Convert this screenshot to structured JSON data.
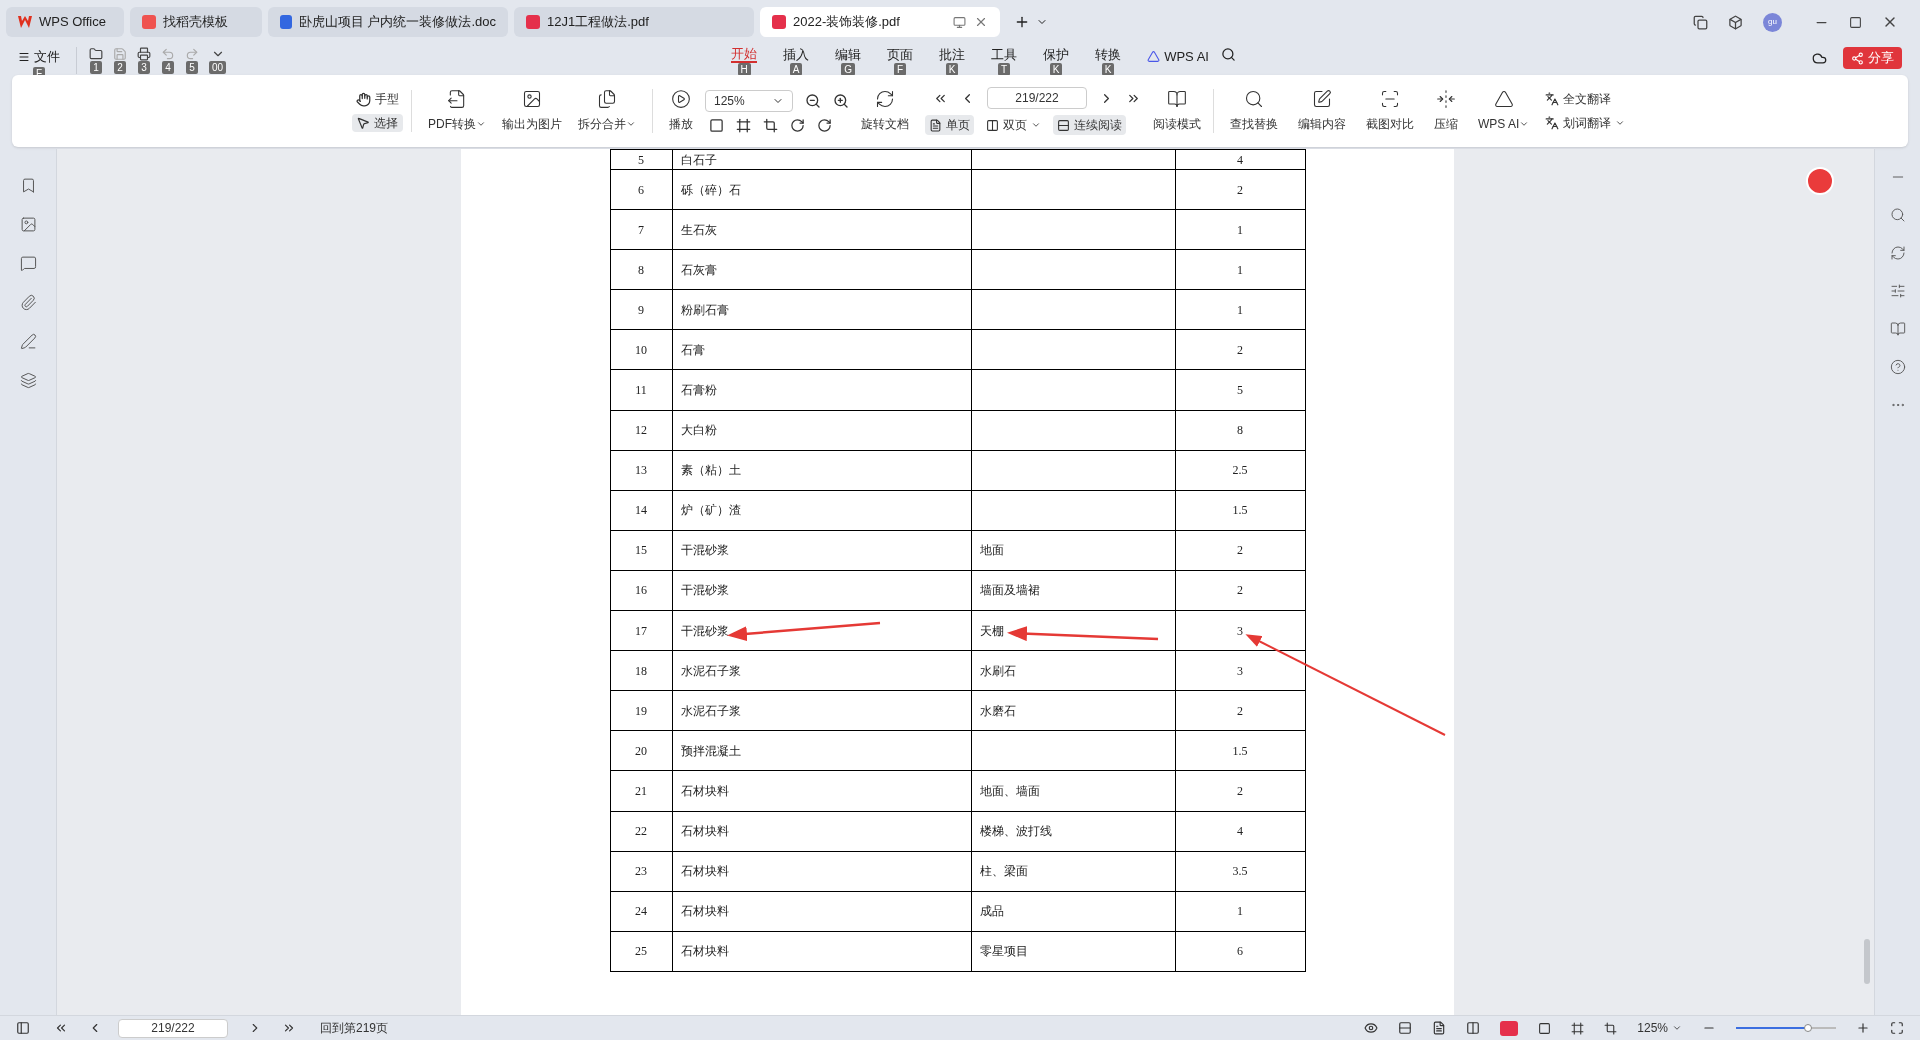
{
  "tabs": [
    {
      "label": "WPS Office",
      "kind": "home",
      "selected": false
    },
    {
      "label": "找稻壳模板",
      "kind": "template",
      "selected": false
    },
    {
      "label": "卧虎山项目 户内统一装修做法.doc",
      "kind": "doc",
      "selected": false
    },
    {
      "label": "12J1工程做法.pdf",
      "kind": "pdf",
      "selected": false
    },
    {
      "label": "2022-装饰装修.pdf",
      "kind": "pdf",
      "selected": true
    }
  ],
  "avatar": "gu",
  "quick_access": {
    "label": "文件",
    "hint": "F",
    "tool_hints": [
      "1",
      "2",
      "3",
      "4",
      "5",
      "00"
    ]
  },
  "menu": [
    {
      "label": "开始",
      "hint": "H",
      "selected": true
    },
    {
      "label": "插入",
      "hint": "A",
      "selected": false
    },
    {
      "label": "编辑",
      "hint": "G",
      "selected": false
    },
    {
      "label": "页面",
      "hint": "F",
      "selected": false
    },
    {
      "label": "批注",
      "hint": "K",
      "selected": false
    },
    {
      "label": "工具",
      "hint": "T",
      "selected": false
    },
    {
      "label": "保护",
      "hint": "K",
      "selected": false
    },
    {
      "label": "转换",
      "hint": "K",
      "selected": false
    }
  ],
  "wps_ai": "WPS AI",
  "share": "分享",
  "toolbar": {
    "hand": "手型",
    "select": "选择",
    "select_selected": true,
    "pdf_convert": "PDF转换",
    "export_image": "输出为图片",
    "split_merge": "拆分合并",
    "play": "播放",
    "zoom": "125%",
    "rotate": "旋转文档",
    "page": "219/222",
    "views": [
      {
        "label": "单页",
        "selected": true,
        "dropdown": false
      },
      {
        "label": "双页",
        "selected": false,
        "dropdown": true
      },
      {
        "label": "连续阅读",
        "selected": true,
        "dropdown": false
      }
    ],
    "read_mode": "阅读模式",
    "tools": [
      "查找替换",
      "编辑内容",
      "截图对比",
      "压缩"
    ],
    "ai": "WPS AI",
    "full_translate": "全文翻译",
    "word_translate": "划词翻译"
  },
  "table": {
    "rows": [
      [
        "5",
        "白石子",
        "",
        "4"
      ],
      [
        "6",
        "砾（碎）石",
        "",
        "2"
      ],
      [
        "7",
        "生石灰",
        "",
        "1"
      ],
      [
        "8",
        "石灰膏",
        "",
        "1"
      ],
      [
        "9",
        "粉刷石膏",
        "",
        "1"
      ],
      [
        "10",
        "石膏",
        "",
        "2"
      ],
      [
        "11",
        "石膏粉",
        "",
        "5"
      ],
      [
        "12",
        "大白粉",
        "",
        "8"
      ],
      [
        "13",
        "素（粘）土",
        "",
        "2.5"
      ],
      [
        "14",
        "炉（矿）渣",
        "",
        "1.5"
      ],
      [
        "15",
        "干混砂浆",
        "地面",
        "2"
      ],
      [
        "16",
        "干混砂浆",
        "墙面及墙裙",
        "2"
      ],
      [
        "17",
        "干混砂浆",
        "天棚",
        "3"
      ],
      [
        "18",
        "水泥石子浆",
        "水刷石",
        "3"
      ],
      [
        "19",
        "水泥石子浆",
        "水磨石",
        "2"
      ],
      [
        "20",
        "预拌混凝土",
        "",
        "1.5"
      ],
      [
        "21",
        "石材块料",
        "地面、墙面",
        "2"
      ],
      [
        "22",
        "石材块料",
        "楼梯、波打线",
        "4"
      ],
      [
        "23",
        "石材块料",
        "柱、梁面",
        "3.5"
      ],
      [
        "24",
        "石材块料",
        "成品",
        "1"
      ],
      [
        "25",
        "石材块料",
        "零星项目",
        "6"
      ]
    ]
  },
  "status_bar": {
    "page": "219/222",
    "back": "回到第219页",
    "zoom": "125%",
    "zoom_slider": {
      "level": 0.72
    }
  }
}
